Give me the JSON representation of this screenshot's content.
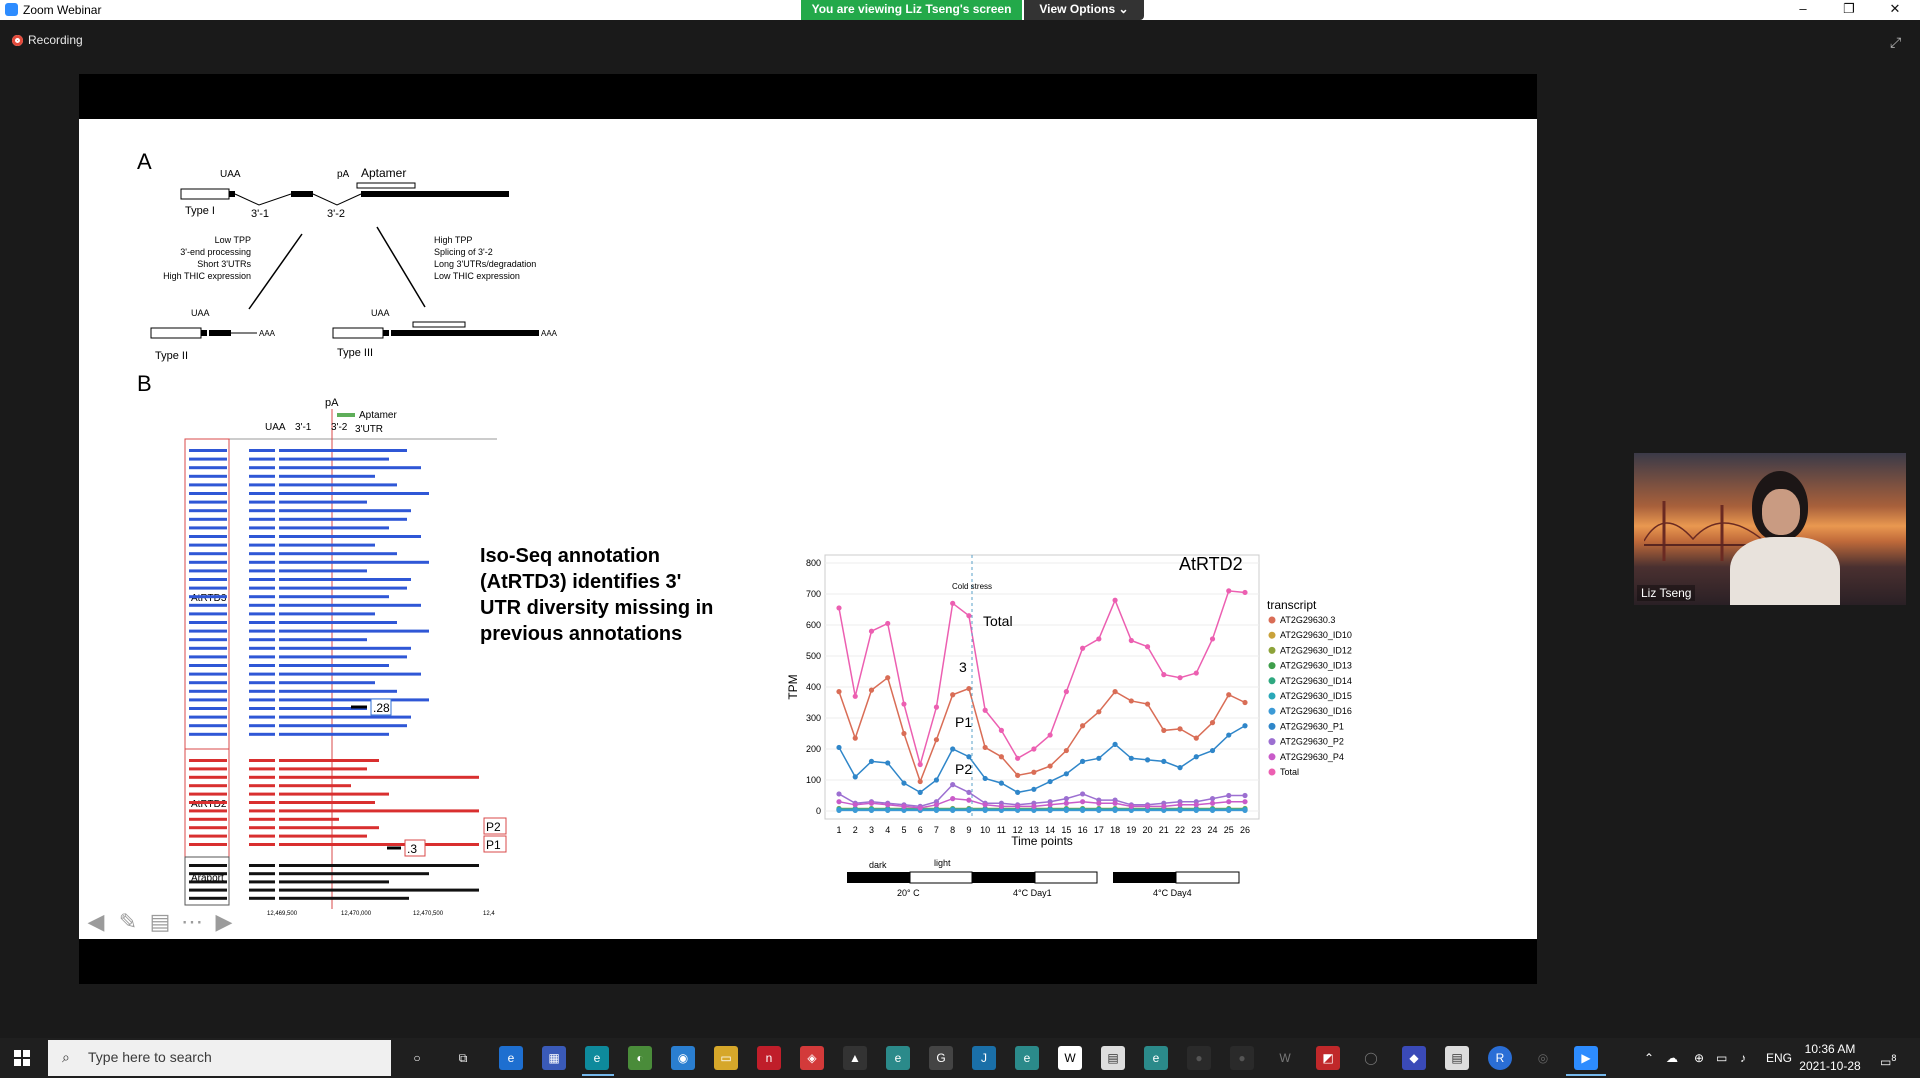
{
  "window": {
    "app_title": "Zoom Webinar",
    "viewing_banner": "You are viewing Liz Tseng's screen",
    "view_options_label": "View Options",
    "recording_label": "Recording"
  },
  "slide": {
    "panel_a_label": "A",
    "panel_b_label": "B",
    "diagram_a": {
      "uaa": "UAA",
      "pa": "pA",
      "aptamer": "Aptamer",
      "type1": "Type I",
      "type2": "Type II",
      "type3": "Type III",
      "site1": "3'-1",
      "site2": "3'-2",
      "aaa": "AAA",
      "left_notes": [
        "Low TPP",
        "3'-end processing",
        "Short 3'UTRs",
        "High THIC expression"
      ],
      "right_notes": [
        "High TPP",
        "Splicing of 3'-2",
        "Long 3'UTRs/degradation",
        "Low THIC expression"
      ]
    },
    "diagram_b": {
      "pa": "pA",
      "uaa": "UAA",
      "site1": "3'-1",
      "site2": "3'-2",
      "legend_aptamer": "Aptamer",
      "legend_utr": "3'UTR",
      "group_atrtd3": "AtRTD3",
      "group_atrtd2": "AtRTD2",
      "group_araport": "Araport",
      "tag_28": ".28",
      "tag_p2": "P2",
      "tag_p1": "P1",
      "tag_3": ".3",
      "axis_ticks": [
        "12,469,500",
        "12,470,000",
        "12,470,500",
        "12,4"
      ]
    },
    "headline": "Iso-Seq annotation (AtRTD3) identifies 3' UTR diversity missing in previous annotations",
    "chart_label_atrtd2": "AtRTD2",
    "cold_stress": "Cold stress",
    "annotations": {
      "total": "Total",
      "three": "3",
      "p1": "P1",
      "p2": "P2"
    },
    "timeline": {
      "dark": "dark",
      "light": "light",
      "t1": "20° C",
      "t2": "4°C Day1",
      "t3": "4°C Day4"
    }
  },
  "chart_data": {
    "type": "line",
    "title": "",
    "xlabel": "Time points",
    "ylabel": "TPM",
    "ylim": [
      0,
      800
    ],
    "yticks": [
      0,
      100,
      200,
      300,
      400,
      500,
      600,
      700,
      800
    ],
    "x": [
      1,
      2,
      3,
      4,
      5,
      6,
      7,
      8,
      9,
      10,
      11,
      12,
      13,
      14,
      15,
      16,
      17,
      18,
      19,
      20,
      21,
      22,
      23,
      24,
      25,
      26
    ],
    "legend_title": "transcript",
    "legend_position": "right",
    "series": [
      {
        "name": "AT2G29630.3",
        "color": "#d96d56",
        "values": [
          385,
          235,
          390,
          430,
          250,
          95,
          230,
          375,
          395,
          205,
          175,
          115,
          125,
          145,
          195,
          275,
          320,
          385,
          355,
          345,
          260,
          265,
          235,
          285,
          375,
          350
        ]
      },
      {
        "name": "AT2G29630_ID10",
        "color": "#c9a23a",
        "values": [
          5,
          5,
          5,
          5,
          5,
          5,
          5,
          5,
          5,
          5,
          5,
          5,
          5,
          5,
          5,
          5,
          5,
          5,
          5,
          5,
          5,
          5,
          5,
          5,
          5,
          5
        ]
      },
      {
        "name": "AT2G29630_ID12",
        "color": "#8da33a",
        "values": [
          8,
          8,
          8,
          8,
          8,
          8,
          8,
          8,
          8,
          8,
          8,
          8,
          8,
          8,
          8,
          8,
          8,
          8,
          8,
          8,
          8,
          8,
          8,
          8,
          8,
          8
        ]
      },
      {
        "name": "AT2G29630_ID13",
        "color": "#3f9e4b",
        "values": [
          3,
          3,
          3,
          3,
          3,
          3,
          3,
          3,
          3,
          3,
          3,
          3,
          3,
          3,
          3,
          3,
          3,
          3,
          3,
          3,
          3,
          3,
          3,
          3,
          3,
          3
        ]
      },
      {
        "name": "AT2G29630_ID14",
        "color": "#2fa880",
        "values": [
          4,
          4,
          4,
          4,
          4,
          4,
          4,
          4,
          4,
          4,
          4,
          4,
          4,
          4,
          4,
          4,
          4,
          4,
          4,
          4,
          4,
          4,
          4,
          4,
          4,
          4
        ]
      },
      {
        "name": "AT2G29630_ID15",
        "color": "#2aa8b8",
        "values": [
          6,
          6,
          6,
          6,
          6,
          6,
          6,
          6,
          6,
          6,
          6,
          6,
          6,
          6,
          6,
          6,
          6,
          6,
          6,
          6,
          6,
          6,
          6,
          6,
          6,
          6
        ]
      },
      {
        "name": "AT2G29630_ID16",
        "color": "#3c9ad6",
        "values": [
          2,
          2,
          2,
          2,
          2,
          2,
          2,
          2,
          2,
          2,
          2,
          2,
          2,
          2,
          2,
          2,
          2,
          2,
          2,
          2,
          2,
          2,
          2,
          2,
          2,
          2
        ]
      },
      {
        "name": "AT2G29630_P1",
        "color": "#2f86c9",
        "values": [
          205,
          110,
          160,
          155,
          90,
          60,
          100,
          200,
          175,
          105,
          90,
          60,
          70,
          95,
          120,
          160,
          170,
          215,
          170,
          165,
          160,
          140,
          175,
          195,
          245,
          275
        ]
      },
      {
        "name": "AT2G29630_P2",
        "color": "#9c6fd1",
        "values": [
          55,
          25,
          30,
          25,
          20,
          15,
          30,
          85,
          60,
          25,
          25,
          20,
          25,
          30,
          40,
          55,
          35,
          35,
          20,
          20,
          25,
          30,
          30,
          40,
          50,
          50
        ]
      },
      {
        "name": "AT2G29630_P4",
        "color": "#c95bc9",
        "values": [
          30,
          20,
          25,
          20,
          15,
          10,
          20,
          40,
          35,
          20,
          15,
          15,
          15,
          20,
          25,
          30,
          25,
          25,
          15,
          15,
          15,
          20,
          20,
          25,
          30,
          30
        ]
      },
      {
        "name": "Total",
        "color": "#ec5fb1",
        "values": [
          655,
          370,
          580,
          605,
          345,
          150,
          335,
          670,
          630,
          325,
          260,
          170,
          200,
          245,
          385,
          525,
          555,
          680,
          550,
          530,
          440,
          430,
          445,
          555,
          710,
          705
        ]
      }
    ]
  },
  "participant": {
    "name": "Liz Tseng"
  },
  "taskbar": {
    "search_placeholder": "Type here to search",
    "lang": "ENG",
    "time": "10:36 AM",
    "date": "2021-10-28",
    "notif_count": "8"
  }
}
